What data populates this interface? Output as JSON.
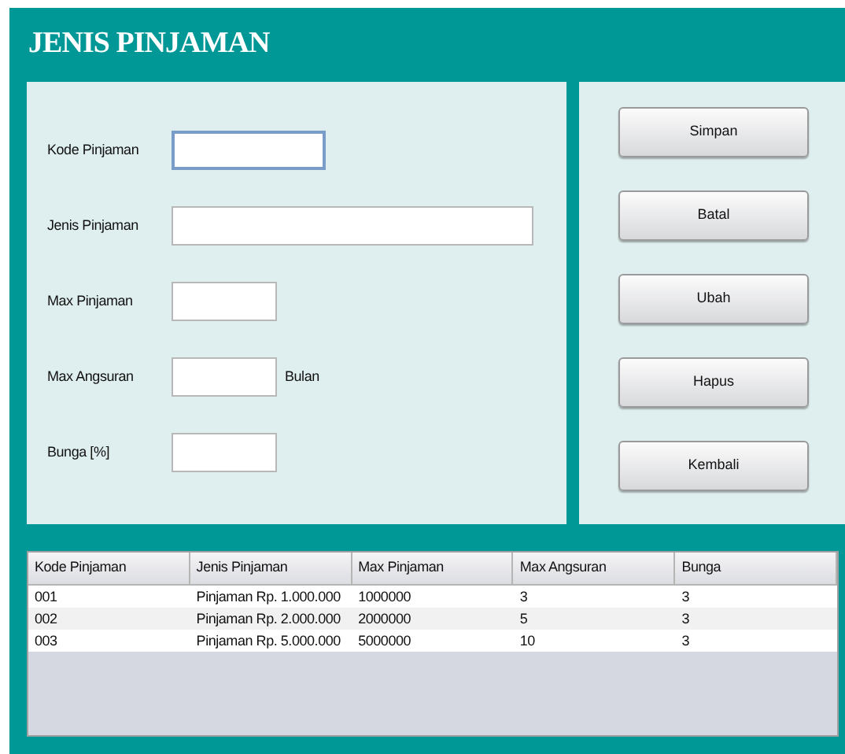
{
  "title": "JENIS PINJAMAN",
  "fields": [
    {
      "label": "Kode Pinjaman",
      "focused": true
    },
    {
      "label": "Jenis Pinjaman",
      "focused": false
    },
    {
      "label": "Max Pinjaman",
      "focused": false
    },
    {
      "label": "Max Angsuran",
      "focused": false,
      "unit": "Bulan"
    },
    {
      "label": "Bunga [%]",
      "focused": false
    }
  ],
  "buttons": [
    "Simpan",
    "Batal",
    "Ubah",
    "Hapus",
    "Kembali"
  ],
  "table": {
    "columns": [
      "Kode Pinjaman",
      "Jenis Pinjaman",
      "Max Pinjaman",
      "Max Angsuran",
      "Bunga"
    ],
    "rows": [
      [
        "001",
        "Pinjaman Rp. 1.000.000",
        "1000000",
        "3",
        "3"
      ],
      [
        "002",
        "Pinjaman Rp. 2.000.000",
        "2000000",
        "5",
        "3"
      ],
      [
        "003",
        "Pinjaman Rp. 5.000.000",
        "5000000",
        "10",
        "3"
      ]
    ]
  }
}
